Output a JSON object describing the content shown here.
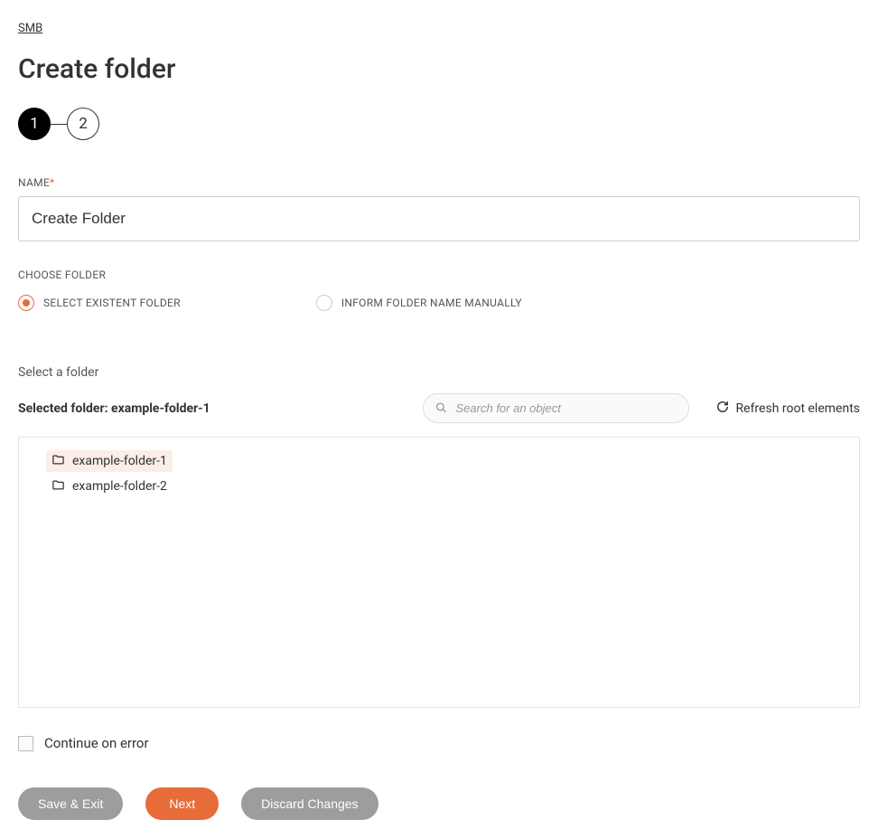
{
  "breadcrumb": "SMB",
  "page_title": "Create folder",
  "stepper": {
    "step1": "1",
    "step2": "2"
  },
  "name_field": {
    "label": "NAME",
    "value": "Create Folder"
  },
  "choose_folder": {
    "label": "CHOOSE FOLDER",
    "option_existent": "SELECT EXISTENT FOLDER",
    "option_manual": "INFORM FOLDER NAME MANUALLY"
  },
  "select_section": {
    "title": "Select a folder",
    "selected_prefix": "Selected folder: ",
    "selected_value": "example-folder-1",
    "search_placeholder": "Search for an object",
    "refresh_label": "Refresh root elements"
  },
  "tree": {
    "items": [
      {
        "label": "example-folder-1",
        "selected": true
      },
      {
        "label": "example-folder-2",
        "selected": false
      }
    ]
  },
  "continue_on_error": "Continue on error",
  "buttons": {
    "save_exit": "Save & Exit",
    "next": "Next",
    "discard": "Discard Changes"
  }
}
